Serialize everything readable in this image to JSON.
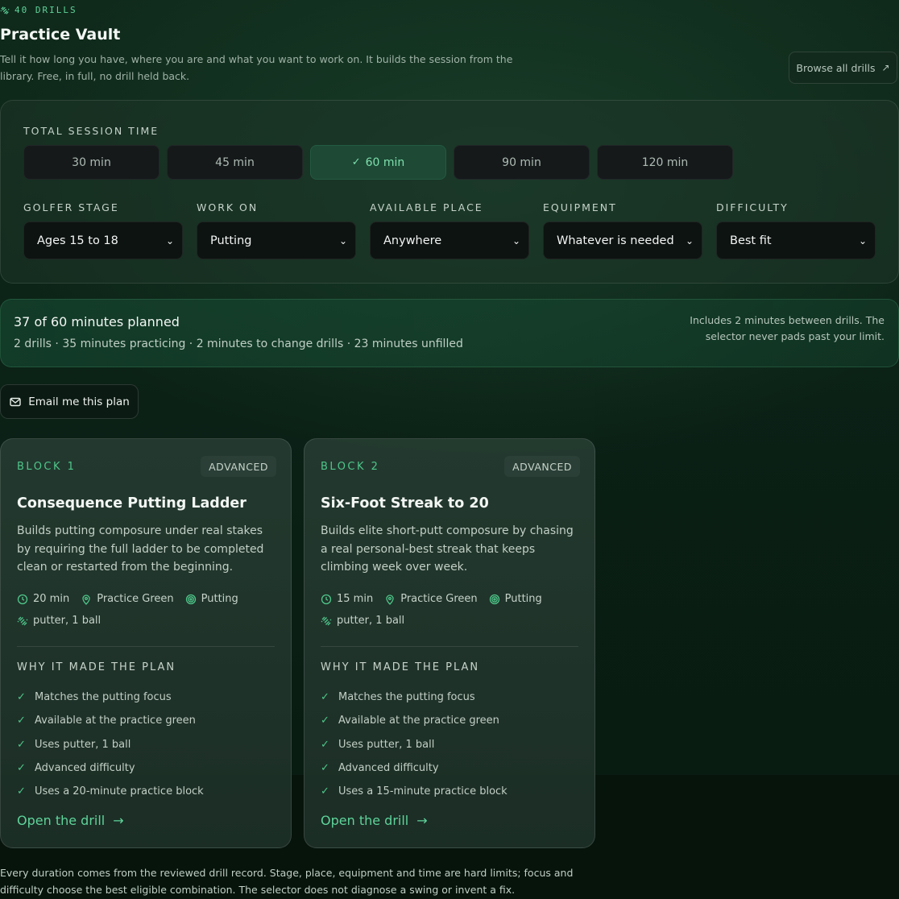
{
  "header": {
    "eyebrow": "40 DRILLS",
    "title": "Practice Vault",
    "lede": "Tell it how long you have, where you are and what you want to work on. It builds the session from the library. Free, in full, no drill held back.",
    "browse_label": "Browse all drills"
  },
  "session": {
    "time_label": "TOTAL SESSION TIME",
    "times": [
      "30 min",
      "45 min",
      "60 min",
      "90 min",
      "120 min"
    ],
    "selected_time": "60 min"
  },
  "filters": [
    {
      "label": "GOLFER STAGE",
      "value": "Ages 15 to 18"
    },
    {
      "label": "WORK ON",
      "value": "Putting"
    },
    {
      "label": "AVAILABLE PLACE",
      "value": "Anywhere"
    },
    {
      "label": "EQUIPMENT",
      "value": "Whatever is needed"
    },
    {
      "label": "DIFFICULTY",
      "value": "Best fit"
    }
  ],
  "summary": {
    "title": "37 of 60 minutes planned",
    "subtitle": "2 drills · 35 minutes practicing · 2 minutes to change drills · 23 minutes unfilled",
    "note": "Includes 2 minutes between drills. The selector never pads past your limit."
  },
  "email_label": "Email me this plan",
  "cards": [
    {
      "block": "BLOCK 1",
      "difficulty": "ADVANCED",
      "name": "Consequence Putting Ladder",
      "desc": "Builds putting composure under real stakes by requiring the full ladder to be completed clean or restarted from the beginning.",
      "duration": "20 min",
      "place": "Practice Green",
      "focus": "Putting",
      "equipment": "putter, 1 ball",
      "why_label": "WHY IT MADE THE PLAN",
      "reasons": [
        "Matches the putting focus",
        "Available at the practice green",
        "Uses putter, 1 ball",
        "Advanced difficulty",
        "Uses a 20-minute practice block"
      ],
      "open_label": "Open the drill"
    },
    {
      "block": "BLOCK 2",
      "difficulty": "ADVANCED",
      "name": "Six-Foot Streak to 20",
      "desc": "Builds elite short-putt composure by chasing a real personal-best streak that keeps climbing week over week.",
      "duration": "15 min",
      "place": "Practice Green",
      "focus": "Putting",
      "equipment": "putter, 1 ball",
      "why_label": "WHY IT MADE THE PLAN",
      "reasons": [
        "Matches the putting focus",
        "Available at the practice green",
        "Uses putter, 1 ball",
        "Advanced difficulty",
        "Uses a 15-minute practice block"
      ],
      "open_label": "Open the drill"
    }
  ],
  "footer": "Every duration comes from the reviewed drill record. Stage, place, equipment and time are hard limits; focus and difficulty choose the best eligible combination. The selector does not diagnose a swing or invent a fix.",
  "colors": {
    "accent": "#5fd39a",
    "background": "#0b2116",
    "active_chip": "#1d4935"
  },
  "icons": {
    "eyebrow": "dumbbell-icon",
    "browse": "arrow-up-right-icon",
    "email": "mail-icon",
    "duration": "clock-icon",
    "place": "map-pin-icon",
    "focus": "target-icon",
    "equipment": "dumbbell-icon",
    "reason": "check-icon",
    "open": "arrow-right-icon"
  }
}
